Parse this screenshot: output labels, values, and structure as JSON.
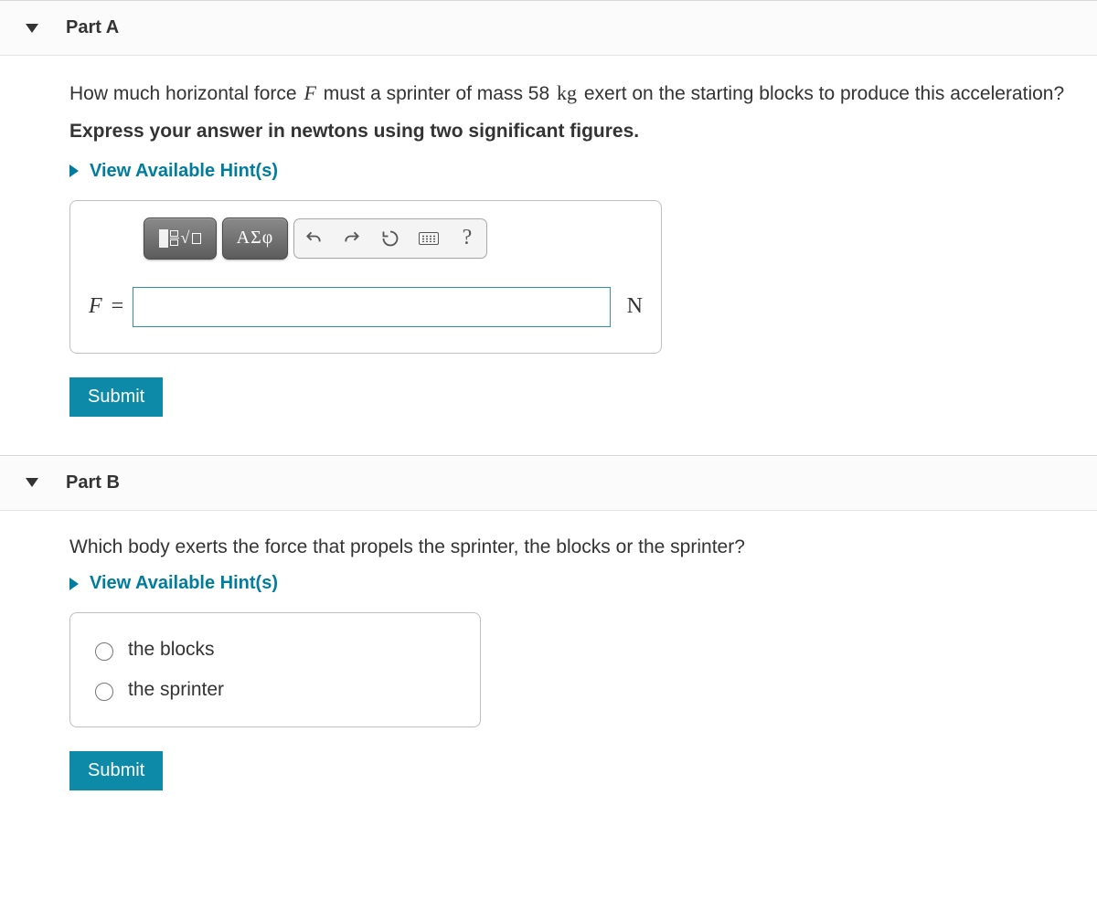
{
  "partA": {
    "header": "Part A",
    "question_pre": "How much horizontal force ",
    "question_var": "F",
    "question_mid": " must a sprinter of mass 58 ",
    "question_unit": "kg",
    "question_post": " exert on the starting blocks to produce this acceleration?",
    "instruction": "Express your answer in newtons using two significant figures.",
    "hints_label": "View Available Hint(s)",
    "toolbar": {
      "symbols_label": "ΑΣφ",
      "help_label": "?"
    },
    "lhs_var": "F",
    "eq": "=",
    "answer_value": "",
    "unit": "N",
    "submit_label": "Submit"
  },
  "partB": {
    "header": "Part B",
    "question": "Which body exerts the force that propels the sprinter, the blocks or the sprinter?",
    "hints_label": "View Available Hint(s)",
    "options": {
      "0": "the blocks",
      "1": "the sprinter"
    },
    "submit_label": "Submit"
  }
}
